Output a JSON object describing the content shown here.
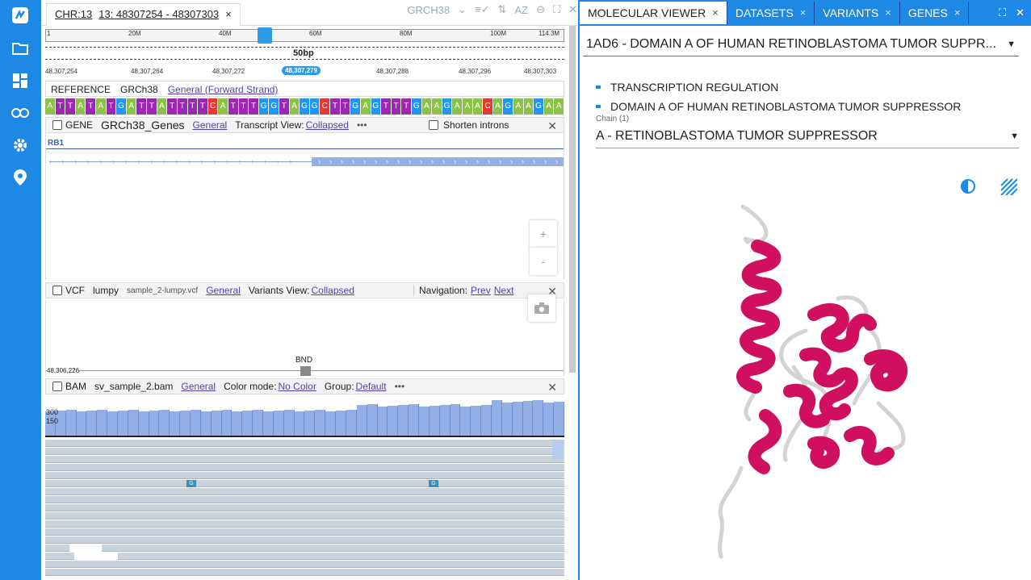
{
  "sidebar": {
    "icons": [
      "logo-icon",
      "folder-icon",
      "dashboard-icon",
      "link-icon",
      "settings-icon",
      "location-icon"
    ]
  },
  "browser": {
    "chr_label": "CHR:13",
    "range_label": "13: 48307254 - 48307303",
    "close": "×",
    "genome": "GRCH38",
    "ruler_ticks": [
      "1",
      "20M",
      "40M",
      "60M",
      "80M",
      "100M",
      "114.3M"
    ],
    "span_label": "50bp",
    "coords": [
      "48,307,254",
      "48,307,264",
      "48,307,272",
      "48,307,279",
      "48,307,288",
      "48,307,296",
      "48,307,303"
    ],
    "reference": {
      "label": "REFERENCE",
      "genome": "GRCh38",
      "link": "General (Forward Strand)"
    },
    "sequence": "ATTATATGATTATTTTCATTTGGTAGGCTTGAGTTTGAAGAAACAGAAGAA",
    "gene_track": {
      "type": "GENE",
      "name": "GRCh38_Genes",
      "general": "General",
      "view_label": "Transcript View:",
      "view": "Collapsed",
      "more": "•••",
      "shorten": "Shorten introns",
      "gene": "RB1",
      "zoom_in": "+",
      "zoom_out": "-"
    },
    "vcf_track": {
      "type": "VCF",
      "name": "lumpy",
      "file": "sample_2-lumpy.vcf",
      "general": "General",
      "view_label": "Variants View:",
      "view": "Collapsed",
      "nav_label": "Navigation:",
      "prev": "Prev",
      "next": "Next",
      "variant": "BND",
      "coord": "48,306,226"
    },
    "bam_track": {
      "type": "BAM",
      "name": "sv_sample_2.bam",
      "general": "General",
      "color_label": "Color mode:",
      "color": "No Color",
      "group_label": "Group:",
      "group": "Default",
      "more": "•••",
      "cov_300": "300",
      "cov_150": "150",
      "mismatch": "G"
    }
  },
  "molecular": {
    "tabs": [
      {
        "label": "MOLECULAR VIEWER",
        "active": true
      },
      {
        "label": "DATASETS",
        "active": false
      },
      {
        "label": "VARIANTS",
        "active": false
      },
      {
        "label": "GENES",
        "active": false
      }
    ],
    "close": "×",
    "pdb": "1AD6  - DOMAIN A OF HUMAN RETINOBLASTOMA TUMOR SUPPR...",
    "info": [
      "TRANSCRIPTION REGULATION",
      "DOMAIN A OF HUMAN RETINOBLASTOMA TUMOR SUPPRESSOR"
    ],
    "chain_label": "Chain (1)",
    "chain": "A - RETINOBLASTOMA TUMOR SUPPRESSOR"
  },
  "colors": {
    "accent": "#1e88e5",
    "helix": "#d0105e",
    "coil": "#d9d9d9"
  }
}
